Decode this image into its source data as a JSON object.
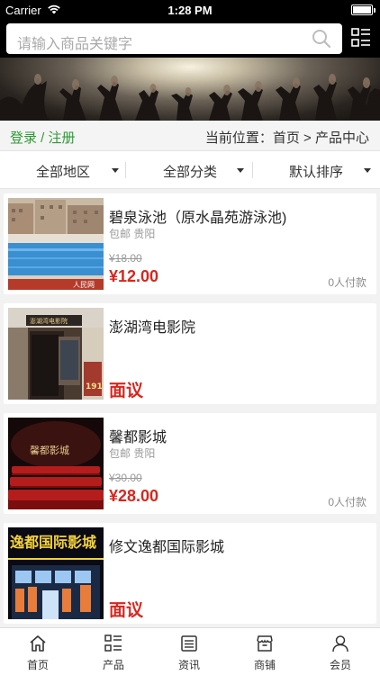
{
  "status": {
    "carrier": "Carrier",
    "time": "1:28 PM",
    "battery_level": 1.0
  },
  "search": {
    "placeholder": "请输入商品关键字"
  },
  "location_bar": {
    "login": "登录",
    "divider": " / ",
    "register": "注册",
    "current_label": "当前位置：",
    "home": "首页",
    "separator": " > ",
    "current": "产品中心"
  },
  "filters": [
    {
      "label": "全部地区"
    },
    {
      "label": "全部分类"
    },
    {
      "label": "默认排序"
    }
  ],
  "products": [
    {
      "name": "碧泉泳池（原水晶苑游泳池)",
      "meta": "包邮  贵阳",
      "old_price": "¥18.00",
      "price": "¥12.00",
      "sold": "0人付款"
    },
    {
      "name": "澎湖湾电影院",
      "price_text": "面议"
    },
    {
      "name": "馨都影城",
      "meta": "包邮  贵阳",
      "old_price": "¥30.00",
      "price": "¥28.00",
      "sold": "0人付款"
    },
    {
      "name": "修文逸都国际影城",
      "price_text": "面议"
    }
  ],
  "thumb_text": {
    "pool_watermark": "人民网",
    "cinema2_sign": "澎湖湾电影院",
    "cinema2_year": "1911",
    "cinema3_sign": "馨都影城",
    "cinema4_sign": "逸都国际影城"
  },
  "tabs": [
    {
      "label": "首页",
      "icon": "home-icon"
    },
    {
      "label": "产品",
      "icon": "grid-list-icon"
    },
    {
      "label": "资讯",
      "icon": "news-icon"
    },
    {
      "label": "商铺",
      "icon": "shop-icon"
    },
    {
      "label": "会员",
      "icon": "user-icon"
    }
  ],
  "colors": {
    "accent_green": "#2f9a36",
    "price_red": "#d7261e",
    "header_bg": "#000000"
  }
}
